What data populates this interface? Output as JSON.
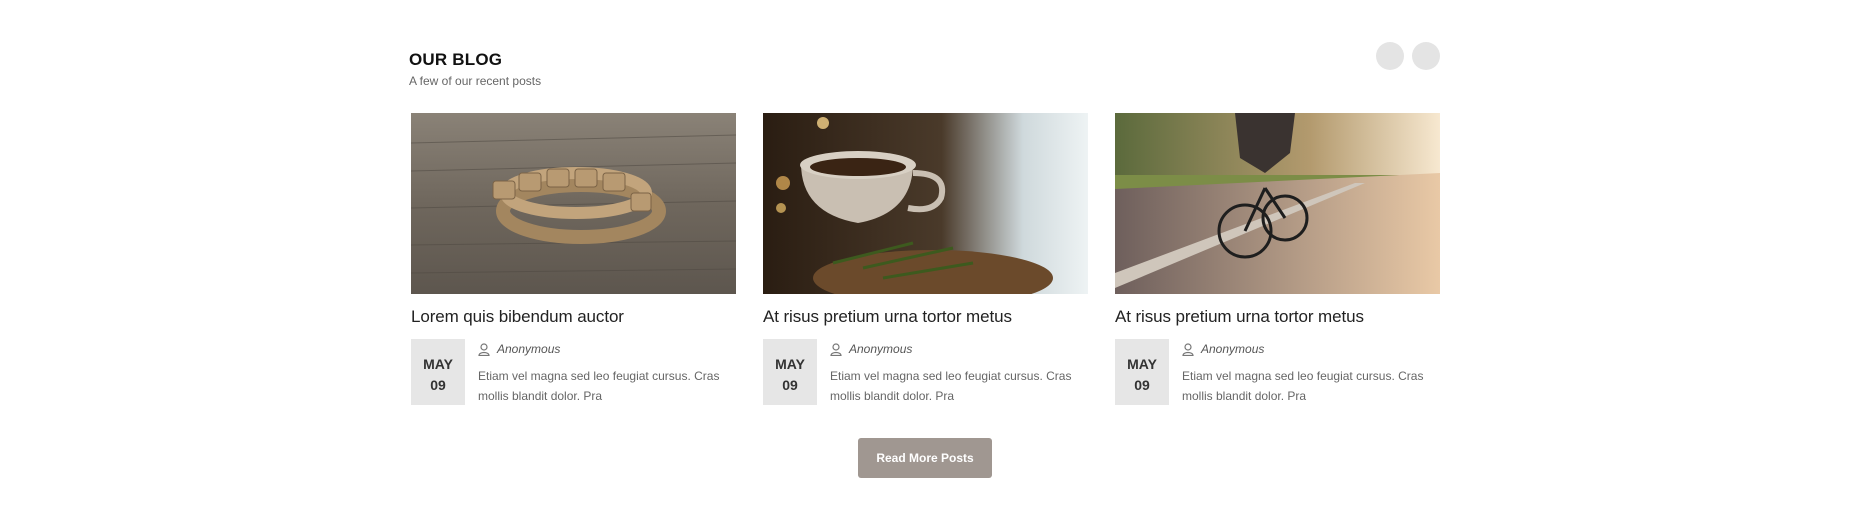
{
  "blog": {
    "title": "OUR BLOG",
    "subtitle": "A few of our recent posts"
  },
  "nav": {
    "prev_icon": "circle-prev-icon",
    "next_icon": "circle-next-icon"
  },
  "posts": [
    {
      "title": "Lorem quis bibendum auctor",
      "image": "wooden-beads-bracelet-image",
      "month": "MAY",
      "day": "09",
      "author": "Anonymous",
      "excerpt": "Etiam vel magna sed leo feugiat cursus. Cras mollis blandit dolor. Pra"
    },
    {
      "title": "At risus pretium urna tortor metus",
      "image": "tea-cup-image",
      "month": "MAY",
      "day": "09",
      "author": "Anonymous",
      "excerpt": "Etiam vel magna sed leo feugiat cursus. Cras mollis blandit dolor. Pra"
    },
    {
      "title": "At risus pretium urna tortor metus",
      "image": "cyclist-road-image",
      "month": "MAY",
      "day": "09",
      "author": "Anonymous",
      "excerpt": "Etiam vel magna sed leo feugiat cursus. Cras mollis blandit dolor. Pra"
    }
  ],
  "read_more_label": "Read More Posts",
  "colors": {
    "button": "#a09791",
    "date_box": "#e6e6e6",
    "nav_dot": "#e4e4e4"
  }
}
